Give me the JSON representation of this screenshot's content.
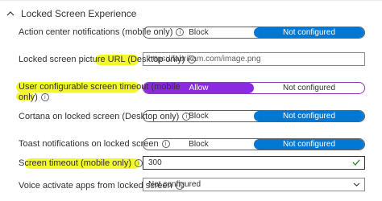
{
  "section": {
    "title": "Locked Screen Experience"
  },
  "settings": [
    {
      "label": "Action center notifications (mobile only)",
      "info": "i",
      "options": [
        "Block",
        "Not configured"
      ],
      "selected": 1
    },
    {
      "label": "Locked screen picture URL (Desktop only)",
      "info": "i",
      "value": "https://fabrikam.com/image.png"
    },
    {
      "label_line1": "User configurable screen timeout (mobile",
      "label_line2": "only)",
      "info": "i",
      "options": [
        "Allow",
        "Not configured"
      ],
      "selected": 0
    },
    {
      "label": "Cortana on locked screen (Desktop only)",
      "info": "i",
      "options": [
        "Block",
        "Not configured"
      ],
      "selected": 1
    },
    {
      "label": "Toast notifications on locked screen",
      "info": "i",
      "options": [
        "Block",
        "Not configured"
      ],
      "selected": 1
    },
    {
      "label": "Screen timeout (mobile only)",
      "info": "i",
      "value": "300"
    },
    {
      "label": "Voice activate apps from locked screen",
      "info": "i",
      "select_value": "Not configured"
    }
  ],
  "colors": {
    "accent": "#0078d4",
    "highlight": "#f3f82a",
    "allow": "#8a2be2"
  },
  "icons": {
    "section_toggle": "chevron-up-icon",
    "info": "info-icon",
    "valid": "checkmark-icon",
    "dropdown": "chevron-down-icon"
  }
}
